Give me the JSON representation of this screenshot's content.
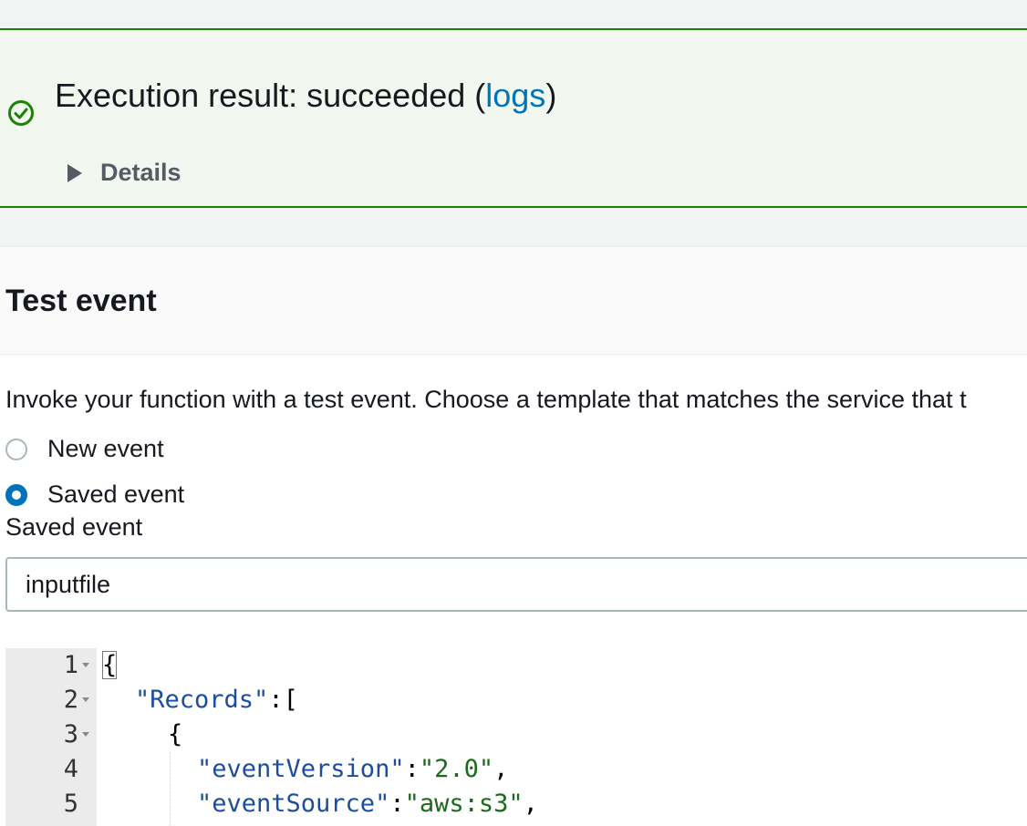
{
  "flash": {
    "title_prefix": "Execution result: succeeded (",
    "logs_link": "logs",
    "title_suffix": ")",
    "details_label": "Details",
    "status_color": "#1d8102"
  },
  "test_event": {
    "title": "Test event",
    "description": "Invoke your function with a test event. Choose a template that matches the service that t",
    "radio_new": "New event",
    "radio_saved": "Saved event",
    "selected_option": "saved",
    "field_label": "Saved event",
    "selected_event": "inputfile"
  },
  "editor": {
    "lines": [
      {
        "num": "1",
        "text": "{"
      },
      {
        "num": "2",
        "key": "\"Records\"",
        "rest": ":["
      },
      {
        "num": "3",
        "text": "{"
      },
      {
        "num": "4",
        "key": "\"eventVersion\"",
        "sep": ":",
        "val": "\"2.0\"",
        "end": ","
      },
      {
        "num": "5",
        "key": "\"eventSource\"",
        "sep": ":",
        "val": "\"aws:s3\"",
        "end": ","
      }
    ]
  }
}
